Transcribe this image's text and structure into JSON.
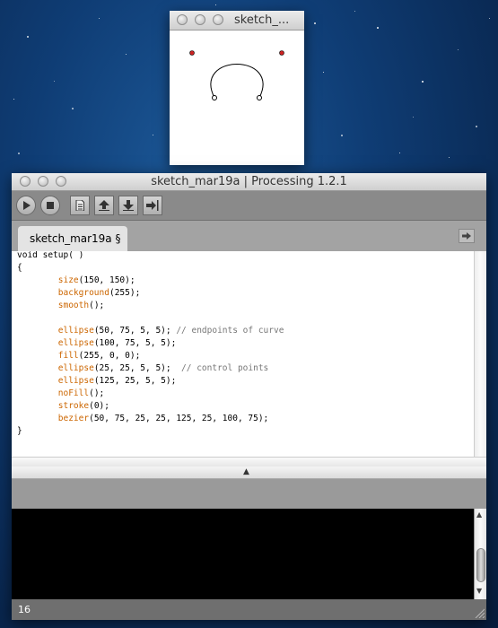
{
  "sketch_window": {
    "title": "sketch_..."
  },
  "ide": {
    "title": "sketch_mar19a | Processing 1.2.1",
    "toolbar": {
      "buttons": [
        "run",
        "stop",
        "new",
        "open",
        "save",
        "export"
      ]
    },
    "tab": {
      "label": "sketch_mar19a §"
    },
    "code_lines": [
      [
        {
          "t": "void setup( )",
          "c": ""
        }
      ],
      [
        {
          "t": "{",
          "c": ""
        }
      ],
      [
        {
          "t": "        ",
          "c": ""
        },
        {
          "t": "size",
          "c": "fn"
        },
        {
          "t": "(150, 150);",
          "c": ""
        }
      ],
      [
        {
          "t": "        ",
          "c": ""
        },
        {
          "t": "background",
          "c": "fn"
        },
        {
          "t": "(255);",
          "c": ""
        }
      ],
      [
        {
          "t": "        ",
          "c": ""
        },
        {
          "t": "smooth",
          "c": "fn"
        },
        {
          "t": "();",
          "c": ""
        }
      ],
      [
        {
          "t": "",
          "c": ""
        }
      ],
      [
        {
          "t": "        ",
          "c": ""
        },
        {
          "t": "ellipse",
          "c": "fn"
        },
        {
          "t": "(50, 75, 5, 5); ",
          "c": ""
        },
        {
          "t": "// endpoints of curve",
          "c": "cm"
        }
      ],
      [
        {
          "t": "        ",
          "c": ""
        },
        {
          "t": "ellipse",
          "c": "fn"
        },
        {
          "t": "(100, 75, 5, 5);",
          "c": ""
        }
      ],
      [
        {
          "t": "        ",
          "c": ""
        },
        {
          "t": "fill",
          "c": "fn"
        },
        {
          "t": "(255, 0, 0);",
          "c": ""
        }
      ],
      [
        {
          "t": "        ",
          "c": ""
        },
        {
          "t": "ellipse",
          "c": "fn"
        },
        {
          "t": "(25, 25, 5, 5);  ",
          "c": ""
        },
        {
          "t": "// control points",
          "c": "cm"
        }
      ],
      [
        {
          "t": "        ",
          "c": ""
        },
        {
          "t": "ellipse",
          "c": "fn"
        },
        {
          "t": "(125, 25, 5, 5);",
          "c": ""
        }
      ],
      [
        {
          "t": "        ",
          "c": ""
        },
        {
          "t": "noFill",
          "c": "fn"
        },
        {
          "t": "();",
          "c": ""
        }
      ],
      [
        {
          "t": "        ",
          "c": ""
        },
        {
          "t": "stroke",
          "c": "fn"
        },
        {
          "t": "(0);",
          "c": ""
        }
      ],
      [
        {
          "t": "        ",
          "c": ""
        },
        {
          "t": "bezier",
          "c": "fn"
        },
        {
          "t": "(50, 75, 25, 25, 125, 25, 100, 75);",
          "c": ""
        }
      ],
      [
        {
          "t": "}",
          "c": ""
        }
      ]
    ],
    "status_line": "16"
  },
  "colors": {
    "keyword_function": "#cc6600",
    "comment": "#777777",
    "control_point_fill": "#cc2222"
  }
}
